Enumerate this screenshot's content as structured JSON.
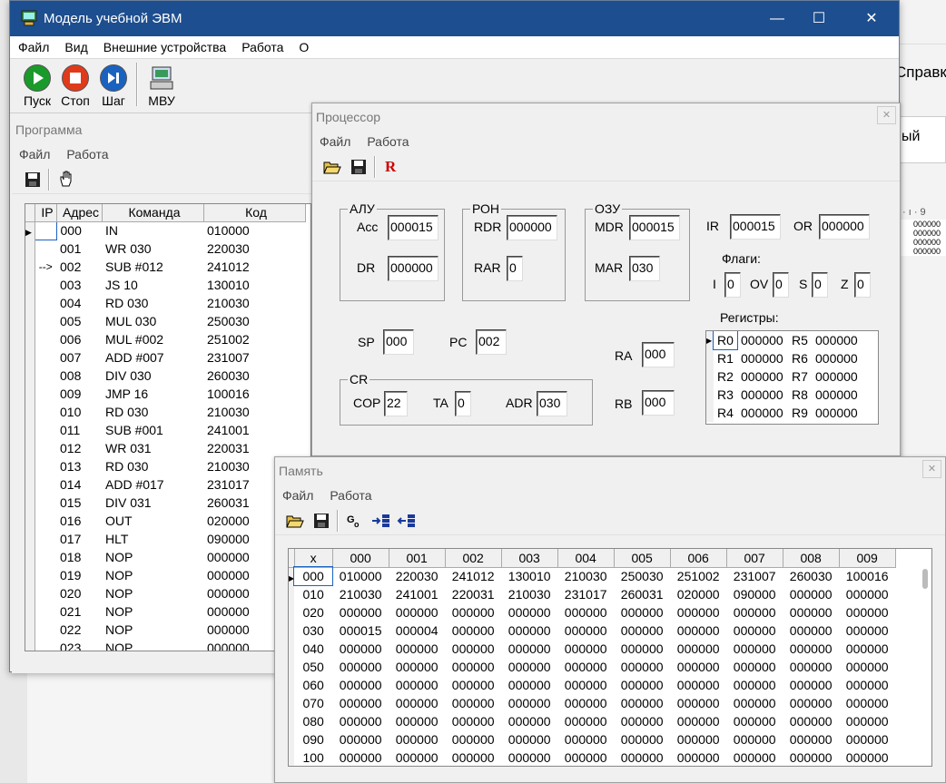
{
  "background": {
    "partial_menu": "Справк",
    "partial_text": "ый",
    "ruler": "· ı · 9",
    "mini_values": [
      "000000",
      "000000",
      "000000",
      "000000"
    ]
  },
  "main": {
    "title": "Модель учебной ЭВМ",
    "menu": [
      "Файл",
      "Вид",
      "Внешние устройства",
      "Работа",
      "О"
    ],
    "toolbar": {
      "run": "Пуск",
      "stop": "Стоп",
      "step": "Шаг",
      "mvu": "МВУ"
    }
  },
  "program": {
    "title": "Программа",
    "menu": [
      "Файл",
      "Работа"
    ],
    "columns": [
      "IP",
      "Адрес",
      "Команда",
      "Код"
    ],
    "rows": [
      [
        "",
        "000",
        "IN",
        "010000"
      ],
      [
        "",
        "001",
        "WR 030",
        "220030"
      ],
      [
        "-->",
        "002",
        "SUB #012",
        "241012"
      ],
      [
        "",
        "003",
        "JS 10",
        "130010"
      ],
      [
        "",
        "004",
        "RD 030",
        "210030"
      ],
      [
        "",
        "005",
        "MUL 030",
        "250030"
      ],
      [
        "",
        "006",
        "MUL #002",
        "251002"
      ],
      [
        "",
        "007",
        "ADD #007",
        "231007"
      ],
      [
        "",
        "008",
        "DIV 030",
        "260030"
      ],
      [
        "",
        "009",
        "JMP 16",
        "100016"
      ],
      [
        "",
        "010",
        "RD 030",
        "210030"
      ],
      [
        "",
        "011",
        "SUB #001",
        "241001"
      ],
      [
        "",
        "012",
        "WR 031",
        "220031"
      ],
      [
        "",
        "013",
        "RD 030",
        "210030"
      ],
      [
        "",
        "014",
        "ADD #017",
        "231017"
      ],
      [
        "",
        "015",
        "DIV 031",
        "260031"
      ],
      [
        "",
        "016",
        "OUT",
        "020000"
      ],
      [
        "",
        "017",
        "HLT",
        "090000"
      ],
      [
        "",
        "018",
        "NOP",
        "000000"
      ],
      [
        "",
        "019",
        "NOP",
        "000000"
      ],
      [
        "",
        "020",
        "NOP",
        "000000"
      ],
      [
        "",
        "021",
        "NOP",
        "000000"
      ],
      [
        "",
        "022",
        "NOP",
        "000000"
      ],
      [
        "",
        "023",
        "NOP",
        "000000"
      ]
    ]
  },
  "processor": {
    "title": "Процессор",
    "menu": [
      "Файл",
      "Работа"
    ],
    "r_label": "R",
    "alu": {
      "legend": "АЛУ",
      "acc_label": "Acc",
      "acc": "000015",
      "dr_label": "DR",
      "dr": "000000"
    },
    "ron": {
      "legend": "РОН",
      "rdr_label": "RDR",
      "rdr": "000000",
      "rar_label": "RAR",
      "rar": "0"
    },
    "ozu": {
      "legend": "ОЗУ",
      "mdr_label": "MDR",
      "mdr": "000015",
      "mar_label": "MAR",
      "mar": "030"
    },
    "ir_label": "IR",
    "ir": "000015",
    "or_label": "OR",
    "or": "000000",
    "flags_label": "Флаги:",
    "flags": {
      "i_label": "I",
      "i": "0",
      "ov_label": "OV",
      "ov": "0",
      "s_label": "S",
      "s": "0",
      "z_label": "Z",
      "z": "0"
    },
    "sp_label": "SP",
    "sp": "000",
    "pc_label": "PC",
    "pc": "002",
    "cr": {
      "legend": "CR",
      "cop_label": "COP",
      "cop": "22",
      "ta_label": "TA",
      "ta": "0",
      "adr_label": "ADR",
      "adr": "030"
    },
    "ra_label": "RA",
    "ra": "000",
    "rb_label": "RB",
    "rb": "000",
    "registers_label": "Регистры:",
    "registers": [
      [
        "R0",
        "000000",
        "R5",
        "000000"
      ],
      [
        "R1",
        "000000",
        "R6",
        "000000"
      ],
      [
        "R2",
        "000000",
        "R7",
        "000000"
      ],
      [
        "R3",
        "000000",
        "R8",
        "000000"
      ],
      [
        "R4",
        "000000",
        "R9",
        "000000"
      ]
    ]
  },
  "memory": {
    "title": "Память",
    "menu": [
      "Файл",
      "Работа"
    ],
    "columns": [
      "x",
      "000",
      "001",
      "002",
      "003",
      "004",
      "005",
      "006",
      "007",
      "008",
      "009"
    ],
    "rows": [
      [
        "000",
        "010000",
        "220030",
        "241012",
        "130010",
        "210030",
        "250030",
        "251002",
        "231007",
        "260030",
        "100016"
      ],
      [
        "010",
        "210030",
        "241001",
        "220031",
        "210030",
        "231017",
        "260031",
        "020000",
        "090000",
        "000000",
        "000000"
      ],
      [
        "020",
        "000000",
        "000000",
        "000000",
        "000000",
        "000000",
        "000000",
        "000000",
        "000000",
        "000000",
        "000000"
      ],
      [
        "030",
        "000015",
        "000004",
        "000000",
        "000000",
        "000000",
        "000000",
        "000000",
        "000000",
        "000000",
        "000000"
      ],
      [
        "040",
        "000000",
        "000000",
        "000000",
        "000000",
        "000000",
        "000000",
        "000000",
        "000000",
        "000000",
        "000000"
      ],
      [
        "050",
        "000000",
        "000000",
        "000000",
        "000000",
        "000000",
        "000000",
        "000000",
        "000000",
        "000000",
        "000000"
      ],
      [
        "060",
        "000000",
        "000000",
        "000000",
        "000000",
        "000000",
        "000000",
        "000000",
        "000000",
        "000000",
        "000000"
      ],
      [
        "070",
        "000000",
        "000000",
        "000000",
        "000000",
        "000000",
        "000000",
        "000000",
        "000000",
        "000000",
        "000000"
      ],
      [
        "080",
        "000000",
        "000000",
        "000000",
        "000000",
        "000000",
        "000000",
        "000000",
        "000000",
        "000000",
        "000000"
      ],
      [
        "090",
        "000000",
        "000000",
        "000000",
        "000000",
        "000000",
        "000000",
        "000000",
        "000000",
        "000000",
        "000000"
      ],
      [
        "100",
        "000000",
        "000000",
        "000000",
        "000000",
        "000000",
        "000000",
        "000000",
        "000000",
        "000000",
        "000000"
      ]
    ]
  },
  "colors": {
    "titlebar": "#1d4e8f",
    "run": "#1a9a2a",
    "stop": "#e03a1a",
    "step": "#1a62c0"
  }
}
